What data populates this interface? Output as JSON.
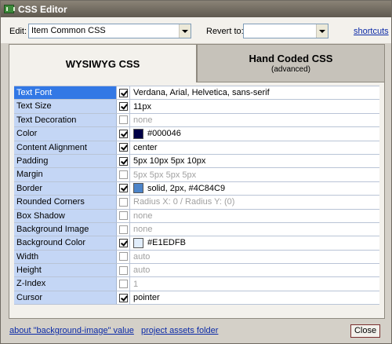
{
  "window": {
    "title": "CSS Editor"
  },
  "toolbar": {
    "edit_label": "Edit:",
    "edit_value": "Item Common CSS",
    "revert_label": "Revert to:",
    "revert_value": "",
    "shortcuts_label": "shortcuts"
  },
  "tabs": {
    "wysiwyg": {
      "label": "WYSIWYG CSS"
    },
    "hand": {
      "label": "Hand Coded CSS",
      "sub": "(advanced)"
    }
  },
  "properties": [
    {
      "name": "Text Font",
      "checked": true,
      "value": "Verdana, Arial, Helvetica, sans-serif",
      "selected": true
    },
    {
      "name": "Text Size",
      "checked": true,
      "value": "11px"
    },
    {
      "name": "Text Decoration",
      "checked": false,
      "value": "none"
    },
    {
      "name": "Color",
      "checked": true,
      "value": "#000046",
      "swatch": "#000046"
    },
    {
      "name": "Content Alignment",
      "checked": true,
      "value": "center"
    },
    {
      "name": "Padding",
      "checked": true,
      "value": "5px 10px 5px 10px"
    },
    {
      "name": "Margin",
      "checked": false,
      "value": "5px 5px 5px 5px"
    },
    {
      "name": "Border",
      "checked": true,
      "value": "solid, 2px, #4C84C9",
      "swatch": "#4C84C9"
    },
    {
      "name": "Rounded Corners",
      "checked": false,
      "value": "Radius X: 0  /  Radius Y: (0)"
    },
    {
      "name": "Box Shadow",
      "checked": false,
      "value": "none"
    },
    {
      "name": "Background Image",
      "checked": false,
      "value": "none"
    },
    {
      "name": "Background Color",
      "checked": true,
      "value": "#E1EDFB",
      "swatch": "#E1EDFB"
    },
    {
      "name": "Width",
      "checked": false,
      "value": "auto"
    },
    {
      "name": "Height",
      "checked": false,
      "value": "auto"
    },
    {
      "name": "Z-Index",
      "checked": false,
      "value": "1"
    },
    {
      "name": "Cursor",
      "checked": true,
      "value": "pointer"
    }
  ],
  "footer": {
    "bg_image_link": "about \"background-image\" value",
    "assets_link": "project assets folder",
    "close_label": "Close"
  }
}
